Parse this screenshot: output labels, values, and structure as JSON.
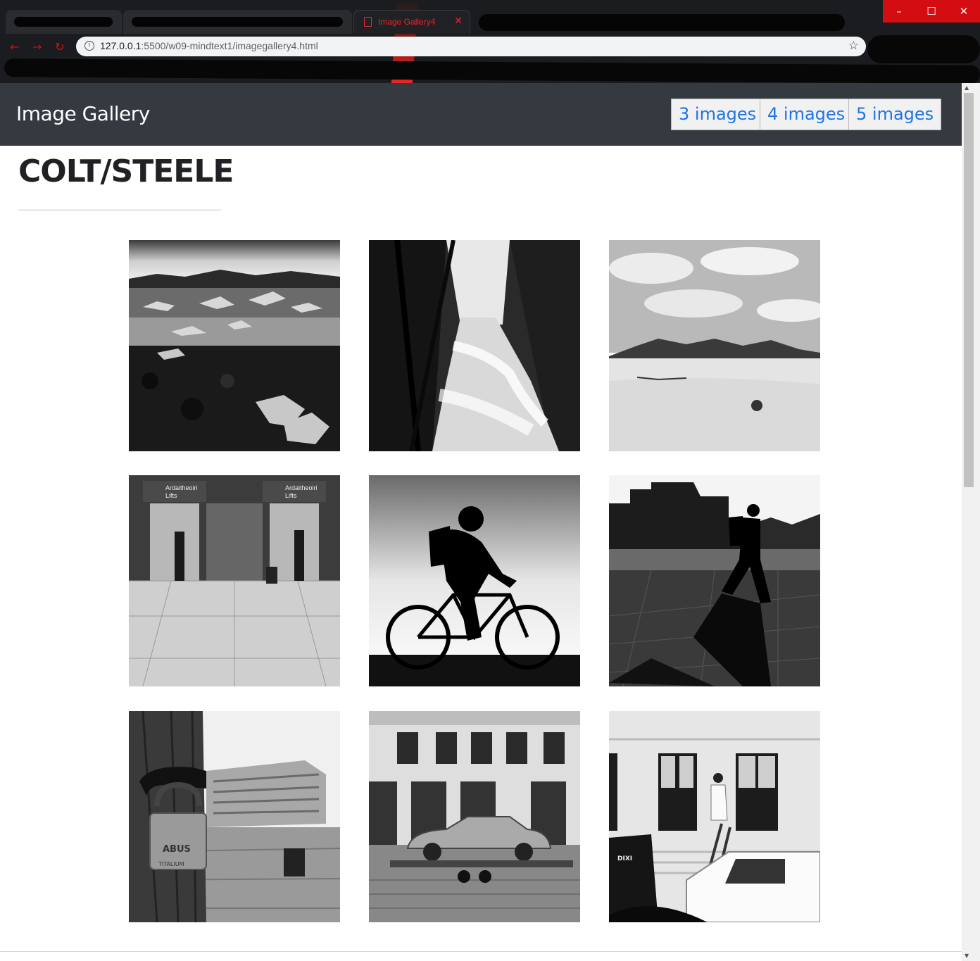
{
  "browser": {
    "active_tab_title": "Image Gallery4",
    "url_host": "127.0.0.1",
    "url_rest": ":5500/w09-mindtext1/imagegallery4.html",
    "window_buttons": [
      "–",
      "☐",
      "✕"
    ]
  },
  "navbar": {
    "brand": "Image Gallery",
    "buttons": [
      "3 images",
      "4 images",
      "5 images"
    ]
  },
  "main": {
    "heading": "COLT/STEELE"
  },
  "gallery": {
    "images": [
      {
        "subject": "glacier-lagoon"
      },
      {
        "subject": "forest-waterfall"
      },
      {
        "subject": "desert-dunes"
      },
      {
        "subject": "airport-lifts"
      },
      {
        "subject": "cyclist-silhouette"
      },
      {
        "subject": "walking-man-city"
      },
      {
        "subject": "padlock-town"
      },
      {
        "subject": "car-on-trailer"
      },
      {
        "subject": "painter-ladder-van"
      }
    ],
    "lift_sign": "Ardaitheoiri",
    "lift_sign_sub": "Lifts",
    "padlock_brand": "ABUS",
    "padlock_model": "TITALIUM",
    "toilet_brand": "DIXI"
  },
  "colors": {
    "navbar_bg": "#343a40",
    "link_blue": "#1e74e6",
    "close_red": "#d40d12"
  }
}
